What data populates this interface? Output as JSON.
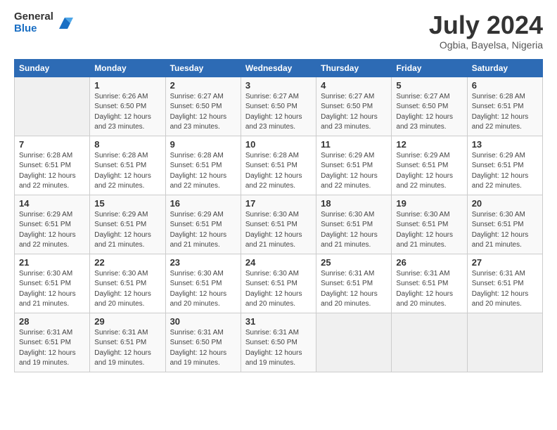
{
  "logo": {
    "general": "General",
    "blue": "Blue"
  },
  "header": {
    "month_year": "July 2024",
    "location": "Ogbia, Bayelsa, Nigeria"
  },
  "days_of_week": [
    "Sunday",
    "Monday",
    "Tuesday",
    "Wednesday",
    "Thursday",
    "Friday",
    "Saturday"
  ],
  "weeks": [
    [
      {
        "day": "",
        "info": ""
      },
      {
        "day": "1",
        "info": "Sunrise: 6:26 AM\nSunset: 6:50 PM\nDaylight: 12 hours\nand 23 minutes."
      },
      {
        "day": "2",
        "info": "Sunrise: 6:27 AM\nSunset: 6:50 PM\nDaylight: 12 hours\nand 23 minutes."
      },
      {
        "day": "3",
        "info": "Sunrise: 6:27 AM\nSunset: 6:50 PM\nDaylight: 12 hours\nand 23 minutes."
      },
      {
        "day": "4",
        "info": "Sunrise: 6:27 AM\nSunset: 6:50 PM\nDaylight: 12 hours\nand 23 minutes."
      },
      {
        "day": "5",
        "info": "Sunrise: 6:27 AM\nSunset: 6:50 PM\nDaylight: 12 hours\nand 23 minutes."
      },
      {
        "day": "6",
        "info": "Sunrise: 6:28 AM\nSunset: 6:51 PM\nDaylight: 12 hours\nand 22 minutes."
      }
    ],
    [
      {
        "day": "7",
        "info": "Sunrise: 6:28 AM\nSunset: 6:51 PM\nDaylight: 12 hours\nand 22 minutes."
      },
      {
        "day": "8",
        "info": "Sunrise: 6:28 AM\nSunset: 6:51 PM\nDaylight: 12 hours\nand 22 minutes."
      },
      {
        "day": "9",
        "info": "Sunrise: 6:28 AM\nSunset: 6:51 PM\nDaylight: 12 hours\nand 22 minutes."
      },
      {
        "day": "10",
        "info": "Sunrise: 6:28 AM\nSunset: 6:51 PM\nDaylight: 12 hours\nand 22 minutes."
      },
      {
        "day": "11",
        "info": "Sunrise: 6:29 AM\nSunset: 6:51 PM\nDaylight: 12 hours\nand 22 minutes."
      },
      {
        "day": "12",
        "info": "Sunrise: 6:29 AM\nSunset: 6:51 PM\nDaylight: 12 hours\nand 22 minutes."
      },
      {
        "day": "13",
        "info": "Sunrise: 6:29 AM\nSunset: 6:51 PM\nDaylight: 12 hours\nand 22 minutes."
      }
    ],
    [
      {
        "day": "14",
        "info": "Sunrise: 6:29 AM\nSunset: 6:51 PM\nDaylight: 12 hours\nand 22 minutes."
      },
      {
        "day": "15",
        "info": "Sunrise: 6:29 AM\nSunset: 6:51 PM\nDaylight: 12 hours\nand 21 minutes."
      },
      {
        "day": "16",
        "info": "Sunrise: 6:29 AM\nSunset: 6:51 PM\nDaylight: 12 hours\nand 21 minutes."
      },
      {
        "day": "17",
        "info": "Sunrise: 6:30 AM\nSunset: 6:51 PM\nDaylight: 12 hours\nand 21 minutes."
      },
      {
        "day": "18",
        "info": "Sunrise: 6:30 AM\nSunset: 6:51 PM\nDaylight: 12 hours\nand 21 minutes."
      },
      {
        "day": "19",
        "info": "Sunrise: 6:30 AM\nSunset: 6:51 PM\nDaylight: 12 hours\nand 21 minutes."
      },
      {
        "day": "20",
        "info": "Sunrise: 6:30 AM\nSunset: 6:51 PM\nDaylight: 12 hours\nand 21 minutes."
      }
    ],
    [
      {
        "day": "21",
        "info": "Sunrise: 6:30 AM\nSunset: 6:51 PM\nDaylight: 12 hours\nand 21 minutes."
      },
      {
        "day": "22",
        "info": "Sunrise: 6:30 AM\nSunset: 6:51 PM\nDaylight: 12 hours\nand 20 minutes."
      },
      {
        "day": "23",
        "info": "Sunrise: 6:30 AM\nSunset: 6:51 PM\nDaylight: 12 hours\nand 20 minutes."
      },
      {
        "day": "24",
        "info": "Sunrise: 6:30 AM\nSunset: 6:51 PM\nDaylight: 12 hours\nand 20 minutes."
      },
      {
        "day": "25",
        "info": "Sunrise: 6:31 AM\nSunset: 6:51 PM\nDaylight: 12 hours\nand 20 minutes."
      },
      {
        "day": "26",
        "info": "Sunrise: 6:31 AM\nSunset: 6:51 PM\nDaylight: 12 hours\nand 20 minutes."
      },
      {
        "day": "27",
        "info": "Sunrise: 6:31 AM\nSunset: 6:51 PM\nDaylight: 12 hours\nand 20 minutes."
      }
    ],
    [
      {
        "day": "28",
        "info": "Sunrise: 6:31 AM\nSunset: 6:51 PM\nDaylight: 12 hours\nand 19 minutes."
      },
      {
        "day": "29",
        "info": "Sunrise: 6:31 AM\nSunset: 6:51 PM\nDaylight: 12 hours\nand 19 minutes."
      },
      {
        "day": "30",
        "info": "Sunrise: 6:31 AM\nSunset: 6:50 PM\nDaylight: 12 hours\nand 19 minutes."
      },
      {
        "day": "31",
        "info": "Sunrise: 6:31 AM\nSunset: 6:50 PM\nDaylight: 12 hours\nand 19 minutes."
      },
      {
        "day": "",
        "info": ""
      },
      {
        "day": "",
        "info": ""
      },
      {
        "day": "",
        "info": ""
      }
    ]
  ]
}
